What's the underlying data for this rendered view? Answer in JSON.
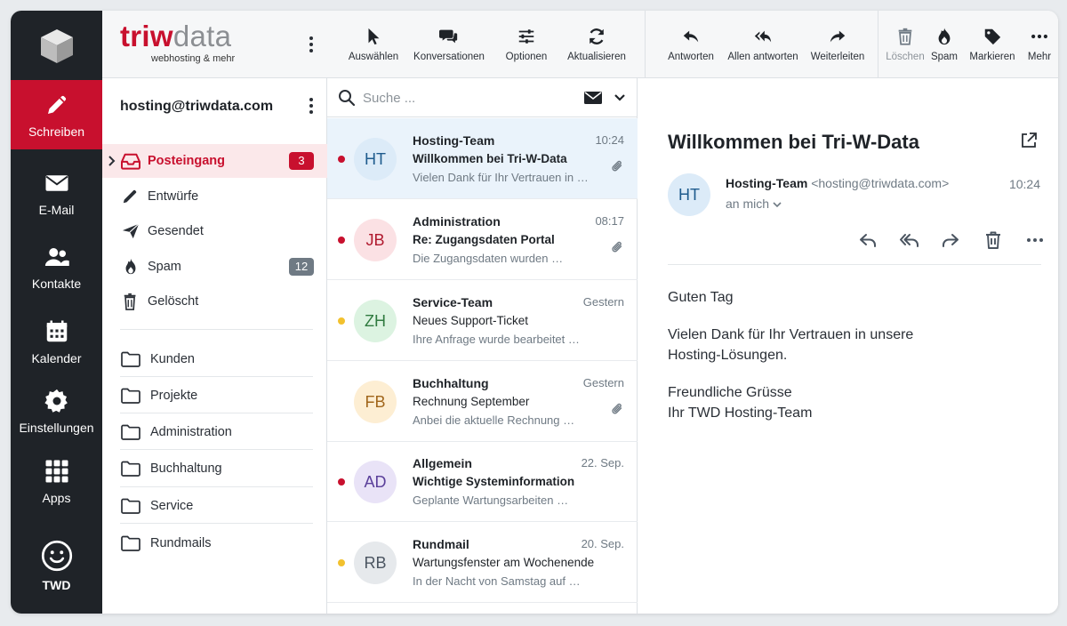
{
  "brand": {
    "name_part1": "triw",
    "name_part2": "data",
    "tagline": "webhosting & mehr"
  },
  "rail": {
    "items": [
      {
        "label": "Schreiben",
        "icon": "pencil-icon"
      },
      {
        "label": "E-Mail",
        "icon": "envelope-icon"
      },
      {
        "label": "Kontakte",
        "icon": "contacts-icon"
      },
      {
        "label": "Kalender",
        "icon": "calendar-icon"
      },
      {
        "label": "Einstellungen",
        "icon": "gear-icon"
      },
      {
        "label": "Apps",
        "icon": "apps-grid-icon"
      },
      {
        "label": "TWD",
        "icon": "smiley-icon"
      }
    ],
    "active_color": "#c8102e"
  },
  "account": "hosting@triwdata.com",
  "folders": [
    {
      "name": "Posteingang",
      "count": "3"
    },
    {
      "name": "Entwürfe"
    },
    {
      "name": "Gesendet"
    },
    {
      "name": "Spam",
      "count": "12"
    },
    {
      "name": "Gelöscht"
    }
  ],
  "custom_folders": [
    "Kunden",
    "Projekte",
    "Administration",
    "Buchhaltung",
    "Service",
    "Rundmails"
  ],
  "toolbar": {
    "select": "Auswählen",
    "conversations": "Konversationen",
    "options": "Optionen",
    "refresh": "Aktualisieren",
    "reply": "Antworten",
    "reply_all": "Allen antworten",
    "forward": "Weiterleiten",
    "delete": "Löschen",
    "spam": "Spam",
    "mark": "Markieren",
    "more": "Mehr"
  },
  "search": {
    "placeholder": "Suche ..."
  },
  "messages": [
    {
      "initials": "HT",
      "from": "Hosting-Team",
      "time": "10:24",
      "subject": "Willkommen bei Tri-W-Data",
      "preview": "Vielen Dank für Ihr Vertrauen in …",
      "dot": "#c8102e",
      "attachment": true,
      "avatar_bg": "#dcebf8",
      "avatar_fg": "#1e5b8d"
    },
    {
      "initials": "JB",
      "from": "Administration",
      "time": "08:17",
      "subject": "Re: Zugangsdaten Portal",
      "preview": "Die Zugangsdaten wurden …",
      "dot": "#c8102e",
      "attachment": true,
      "avatar_bg": "#fbe1e4",
      "avatar_fg": "#b0182d"
    },
    {
      "initials": "ZH",
      "from": "Service-Team",
      "time": "Gestern",
      "subject": "Neues Support-Ticket",
      "preview": "Ihre Anfrage wurde bearbeitet …",
      "dot": "#f2c12e",
      "attachment": false,
      "avatar_bg": "#dcf3e1",
      "avatar_fg": "#2f7a3f"
    },
    {
      "initials": "FB",
      "from": "Buchhaltung",
      "time": "Gestern",
      "subject": "Rechnung September",
      "preview": "Anbei die aktuelle Rechnung …",
      "dot": "",
      "attachment": true,
      "avatar_bg": "#fdeed3",
      "avatar_fg": "#a0651a"
    },
    {
      "initials": "AD",
      "from": "Allgemein",
      "time": "22. Sep.",
      "subject": "Wichtige Systeminformation",
      "preview": "Geplante Wartungsarbeiten …",
      "dot": "#c8102e",
      "attachment": false,
      "avatar_bg": "#e9e3f7",
      "avatar_fg": "#5a3f9a"
    },
    {
      "initials": "RB",
      "from": "Rundmail",
      "time": "20. Sep.",
      "subject": "Wartungsfenster am Wochenende",
      "preview": "In der Nacht von Samstag auf …",
      "dot": "#f2c12e",
      "attachment": false,
      "avatar_bg": "#e6e9ec",
      "avatar_fg": "#4a5460"
    }
  ],
  "reader": {
    "title": "Willkommen bei Tri-W-Data",
    "initials": "HT",
    "from_name": "Hosting-Team",
    "from_addr": "<hosting@triwdata.com>",
    "time": "10:24",
    "to": "an mich",
    "body": [
      "Guten Tag",
      "Vielen Dank für Ihr Vertrauen in unsere Hosting-Lösungen.",
      "Freundliche Grüsse Ihr TWD Hosting-Team"
    ],
    "body_lines": {
      "greeting": "Guten Tag",
      "p1_l1": "Vielen Dank für Ihr Vertrauen in unsere",
      "p1_l2": "Hosting-Lösungen.",
      "p2_l1": "Freundliche Grüsse",
      "p2_l2": "Ihr TWD Hosting-Team"
    }
  }
}
